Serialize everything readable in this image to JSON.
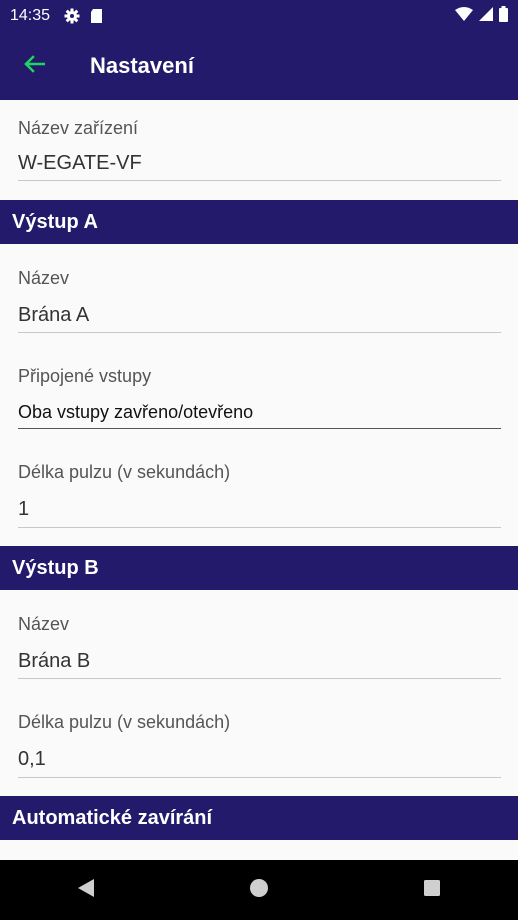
{
  "status_bar": {
    "time": "14:35",
    "icons": [
      "gear-icon",
      "sd-card-icon",
      "wifi-icon",
      "signal-icon",
      "battery-icon"
    ]
  },
  "app_bar": {
    "title": "Nastavení",
    "back_icon": "arrow-left-icon",
    "accent": "#1ed760",
    "background": "#241a6b"
  },
  "device": {
    "name_label": "Název zařízení",
    "name_value": "W-EGATE-VF"
  },
  "output_a": {
    "header": "Výstup A",
    "name_label": "Název",
    "name_value": "Brána A",
    "inputs_label": "Připojené vstupy",
    "inputs_value": "Oba vstupy zavřeno/otevřeno",
    "pulse_label": "Délka pulzu (v sekundách)",
    "pulse_value": "1"
  },
  "output_b": {
    "header": "Výstup B",
    "name_label": "Název",
    "name_value": "Brána B",
    "pulse_label": "Délka pulzu (v sekundách)",
    "pulse_value": "0,1"
  },
  "auto_close": {
    "header": "Automatické zavírání"
  },
  "nav_bar": {
    "icons": [
      "back-triangle-icon",
      "home-circle-icon",
      "recents-square-icon"
    ]
  }
}
